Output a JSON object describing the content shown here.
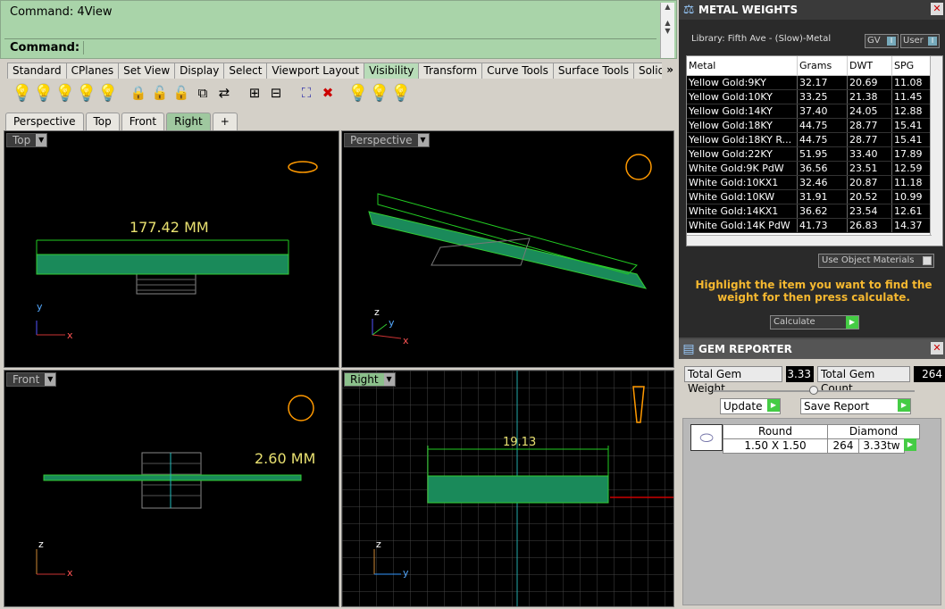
{
  "command": {
    "history": "Command: 4View",
    "prompt_label": "Command:",
    "input_value": ""
  },
  "toolbar_tabs": [
    "Standard",
    "CPlanes",
    "Set View",
    "Display",
    "Select",
    "Viewport Layout",
    "Visibility",
    "Transform",
    "Curve Tools",
    "Surface Tools",
    "Solid Too"
  ],
  "toolbar_active_tab": "Visibility",
  "toolbar_more": "»",
  "viewport_tabs": [
    "Perspective",
    "Top",
    "Front",
    "Right"
  ],
  "viewport_tab_add": "+",
  "viewports": {
    "top": {
      "title": "Top",
      "dimension": "177.42 MM",
      "axis_x": "x",
      "axis_y": "y"
    },
    "perspective": {
      "title": "Perspective",
      "axis_x": "x",
      "axis_y": "y",
      "axis_z": "z"
    },
    "front": {
      "title": "Front",
      "dimension": "2.60 MM",
      "axis_x": "x",
      "axis_z": "z"
    },
    "right": {
      "title": "Right",
      "dimension": "19.13",
      "axis_y": "y",
      "axis_z": "z"
    }
  },
  "metal_weights": {
    "title": "METAL WEIGHTS",
    "library": "Library: Fifth Ave - (Slow)-Metal",
    "gv_label": "GV",
    "user_label": "User",
    "columns": [
      "Metal",
      "Grams",
      "DWT",
      "SPG"
    ],
    "rows": [
      [
        "Yellow Gold:9KY",
        "32.17",
        "20.69",
        "11.08"
      ],
      [
        "Yellow Gold:10KY",
        "33.25",
        "21.38",
        "11.45"
      ],
      [
        "Yellow Gold:14KY",
        "37.40",
        "24.05",
        "12.88"
      ],
      [
        "Yellow Gold:18KY",
        "44.75",
        "28.77",
        "15.41"
      ],
      [
        "Yellow Gold:18KY R...",
        "44.75",
        "28.77",
        "15.41"
      ],
      [
        "Yellow Gold:22KY",
        "51.95",
        "33.40",
        "17.89"
      ],
      [
        "White Gold:9K PdW",
        "36.56",
        "23.51",
        "12.59"
      ],
      [
        "White Gold:10KX1",
        "32.46",
        "20.87",
        "11.18"
      ],
      [
        "White Gold:10KW",
        "31.91",
        "20.52",
        "10.99"
      ],
      [
        "White Gold:14KX1",
        "36.62",
        "23.54",
        "12.61"
      ],
      [
        "White Gold:14K PdW",
        "41.73",
        "26.83",
        "14.37"
      ]
    ],
    "use_object_materials": "Use Object Materials",
    "instruction": "Highlight the item you want to find the weight for then press calculate.",
    "calculate_label": "Calculate"
  },
  "gem_reporter": {
    "title": "GEM REPORTER",
    "total_weight_label": "Total Gem Weight",
    "total_weight_value": "3.33",
    "total_count_label": "Total Gem Count",
    "total_count_value": "264",
    "update_label": "Update",
    "save_label": "Save Report",
    "gem": {
      "shape": "Round",
      "size": "1.50 X 1.50",
      "type": "Diamond",
      "count": "264",
      "weight": "3.33tw"
    }
  },
  "colors": {
    "accent_green": "#a9d4a9",
    "dim_yellow": "#e8e070",
    "object_green": "#1a9a6a",
    "instruction_orange": "#f5b830"
  }
}
